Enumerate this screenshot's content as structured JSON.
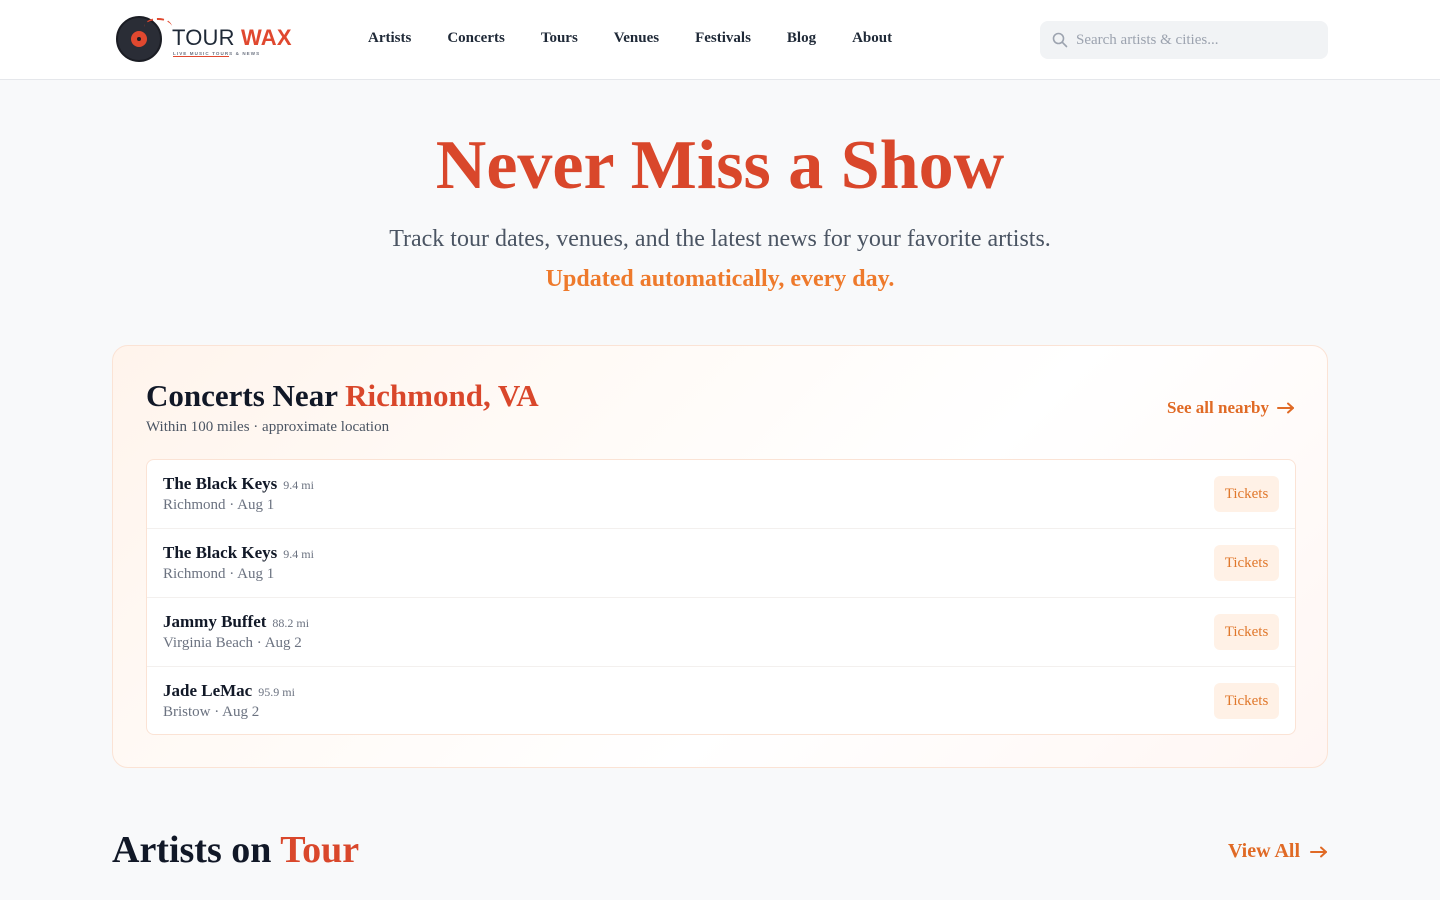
{
  "brand": {
    "name_part1": "TOUR",
    "name_part2": "WAX",
    "tagline": "LIVE MUSIC TOURS & NEWS"
  },
  "nav": {
    "items": [
      {
        "label": "Artists"
      },
      {
        "label": "Concerts"
      },
      {
        "label": "Tours"
      },
      {
        "label": "Venues"
      },
      {
        "label": "Festivals"
      },
      {
        "label": "Blog"
      },
      {
        "label": "About"
      }
    ]
  },
  "search": {
    "placeholder": "Search artists & cities...",
    "value": "",
    "icon": "search-icon"
  },
  "hero": {
    "title": "Never Miss a Show",
    "subtitle": "Track tour dates, venues, and the latest news for your favorite artists.",
    "tagline": "Updated automatically, every day."
  },
  "nearby": {
    "title_prefix": "Concerts Near",
    "city": "Richmond, VA",
    "subtitle": "Within 100 miles · approximate location",
    "see_all_label": "See all nearby",
    "concerts": [
      {
        "artist": "The Black Keys",
        "distance": "9.4 mi",
        "meta": "Richmond · Aug 1",
        "button": "Tickets"
      },
      {
        "artist": "The Black Keys",
        "distance": "9.4 mi",
        "meta": "Richmond · Aug 1",
        "button": "Tickets"
      },
      {
        "artist": "Jammy Buffet",
        "distance": "88.2 mi",
        "meta": "Virginia Beach · Aug 2",
        "button": "Tickets"
      },
      {
        "artist": "Jade LeMac",
        "distance": "95.9 mi",
        "meta": "Bristow · Aug 2",
        "button": "Tickets"
      }
    ]
  },
  "artists_section": {
    "title_prefix": "Artists on",
    "title_accent": "Tour",
    "view_all_label": "View All"
  },
  "colors": {
    "accent_red": "#d9472b",
    "accent_orange": "#ee7a2c",
    "background": "#f8f9fa"
  }
}
